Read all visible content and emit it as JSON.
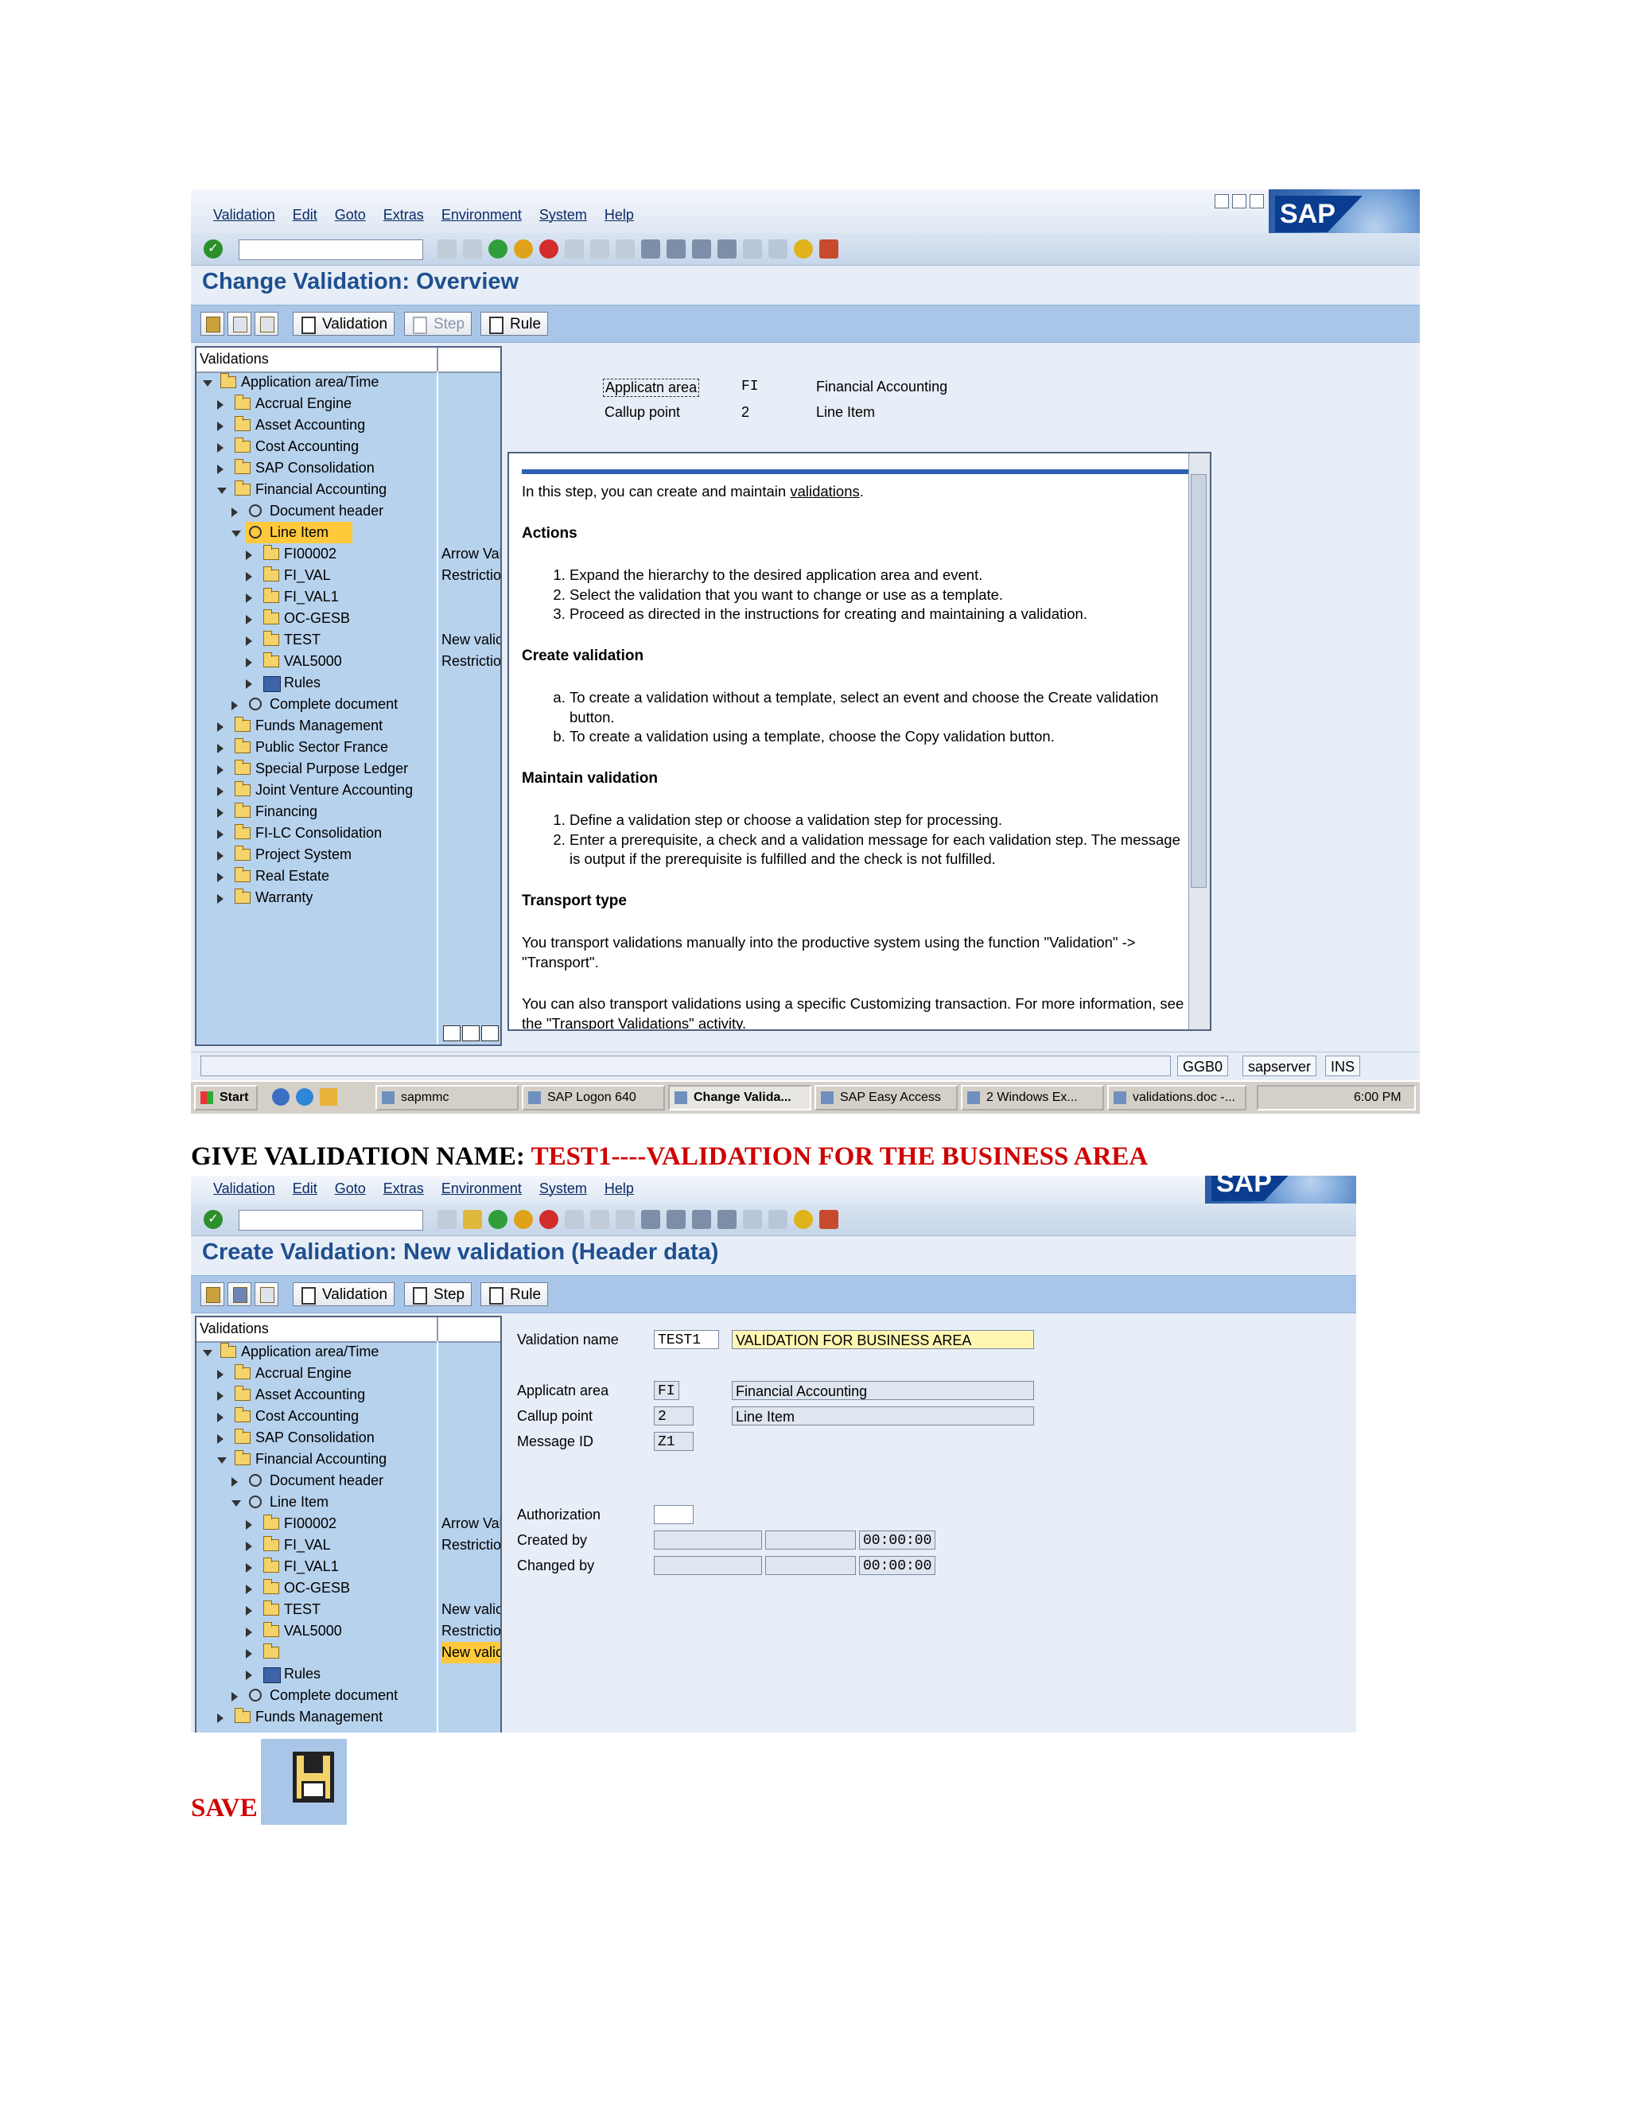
{
  "screen1": {
    "menu": [
      "Validation",
      "Edit",
      "Goto",
      "Extras",
      "Environment",
      "System",
      "Help"
    ],
    "logo_text": "SAP",
    "page_title": "Change Validation: Overview",
    "app_toolbar": {
      "validation": "Validation",
      "step": "Step",
      "rule": "Rule"
    },
    "tree_header": "Validations",
    "tree": [
      {
        "label": "Application area/Time",
        "level": 0,
        "expanded": true,
        "icon": "folder-icon"
      },
      {
        "label": "Accrual Engine",
        "level": 1,
        "icon": "folder-icon"
      },
      {
        "label": "Asset Accounting",
        "level": 1,
        "icon": "folder-icon"
      },
      {
        "label": "Cost Accounting",
        "level": 1,
        "icon": "folder-icon"
      },
      {
        "label": "SAP Consolidation",
        "level": 1,
        "icon": "folder-icon"
      },
      {
        "label": "Financial Accounting",
        "level": 1,
        "expanded": true,
        "icon": "folder-icon"
      },
      {
        "label": "Document header",
        "level": 2,
        "icon": "clock-icon"
      },
      {
        "label": "Line Item",
        "level": 2,
        "expanded": true,
        "icon": "clock-icon",
        "highlight": true
      },
      {
        "label": "FI00002",
        "level": 3,
        "icon": "folder-icon",
        "extra": "Arrow Val"
      },
      {
        "label": "FI_VAL",
        "level": 3,
        "icon": "folder-icon",
        "extra": "Restrictio"
      },
      {
        "label": "FI_VAL1",
        "level": 3,
        "icon": "folder-icon"
      },
      {
        "label": "OC-GESB",
        "level": 3,
        "icon": "folder-icon"
      },
      {
        "label": "TEST",
        "level": 3,
        "icon": "folder-icon",
        "extra": "New valic"
      },
      {
        "label": "VAL5000",
        "level": 3,
        "icon": "folder-icon",
        "extra": "Restrictio"
      },
      {
        "label": "Rules",
        "level": 3,
        "icon": "rules-icon"
      },
      {
        "label": "Complete document",
        "level": 2,
        "icon": "clock-icon"
      },
      {
        "label": "Funds Management",
        "level": 1,
        "icon": "folder-icon"
      },
      {
        "label": "Public Sector France",
        "level": 1,
        "icon": "folder-icon"
      },
      {
        "label": "Special Purpose Ledger",
        "level": 1,
        "icon": "folder-icon"
      },
      {
        "label": "Joint Venture Accounting",
        "level": 1,
        "icon": "folder-icon"
      },
      {
        "label": "Financing",
        "level": 1,
        "icon": "folder-icon"
      },
      {
        "label": "FI-LC Consolidation",
        "level": 1,
        "icon": "folder-icon"
      },
      {
        "label": "Project System",
        "level": 1,
        "icon": "folder-icon"
      },
      {
        "label": "Real Estate",
        "level": 1,
        "icon": "folder-icon"
      },
      {
        "label": "Warranty",
        "level": 1,
        "icon": "folder-icon"
      }
    ],
    "fields": {
      "app_area_label": "Applicatn area",
      "app_area_value": "FI",
      "app_area_text": "Financial Accounting",
      "callup_label": "Callup point",
      "callup_value": "2",
      "callup_text": "Line Item"
    },
    "help": {
      "intro_pre": "In this step, you can create and maintain ",
      "intro_link": "validations",
      "intro_post": ".",
      "actions_title": "Actions",
      "actions": [
        "Expand the hierarchy to the desired application area and event.",
        "Select the validation that you want to change or use as a template.",
        "Proceed as directed in the instructions for creating and maintaining a validation."
      ],
      "create_title": "Create validation",
      "create_items": [
        "To create a validation without a template, select an event and choose the Create validation button.",
        "To create a validation using a template, choose the Copy validation button."
      ],
      "maintain_title": "Maintain validation",
      "maintain_items": [
        "Define a validation step or choose a validation step for processing.",
        "Enter a prerequisite, a check and a validation message for each validation step. The message is output if the prerequisite is fulfilled and the check is not fulfilled."
      ],
      "transport_title": "Transport type",
      "transport_p1": "You transport validations manually into the productive system using the function \"Validation\" -> \"Transport\".",
      "transport_p2_pre": "You can also transport validations using a specific Customizing transaction. For more information, see the ",
      "transport_p2_link": "\"Transport Validations\"",
      "transport_p2_post": " activity."
    },
    "status": {
      "tcode": "GGB0",
      "server": "sapserver",
      "mode": "INS"
    }
  },
  "taskbar": {
    "start": "Start",
    "items": [
      "sapmmc",
      "SAP Logon 640",
      "Change Valida...",
      "SAP Easy Access",
      "2 Windows Ex...",
      "validations.doc -..."
    ],
    "clock": "6:00 PM"
  },
  "heading": {
    "prefix": "GIVE VALIDATION NAME: ",
    "highlight": "TEST1----VALIDATION FOR THE BUSINESS AREA"
  },
  "screen2": {
    "menu": [
      "Validation",
      "Edit",
      "Goto",
      "Extras",
      "Environment",
      "System",
      "Help"
    ],
    "page_title": "Create Validation: New validation (Header data)",
    "app_toolbar": {
      "validation": "Validation",
      "step": "Step",
      "rule": "Rule"
    },
    "tree_header": "Validations",
    "tree": [
      {
        "label": "Application area/Time",
        "level": 0,
        "expanded": true,
        "icon": "folder-icon"
      },
      {
        "label": "Accrual Engine",
        "level": 1,
        "icon": "folder-icon"
      },
      {
        "label": "Asset Accounting",
        "level": 1,
        "icon": "folder-icon"
      },
      {
        "label": "Cost Accounting",
        "level": 1,
        "icon": "folder-icon"
      },
      {
        "label": "SAP Consolidation",
        "level": 1,
        "icon": "folder-icon"
      },
      {
        "label": "Financial Accounting",
        "level": 1,
        "expanded": true,
        "icon": "folder-icon"
      },
      {
        "label": "Document header",
        "level": 2,
        "icon": "clock-icon"
      },
      {
        "label": "Line Item",
        "level": 2,
        "expanded": true,
        "icon": "clock-icon"
      },
      {
        "label": "FI00002",
        "level": 3,
        "icon": "folder-icon",
        "extra": "Arrow Val"
      },
      {
        "label": "FI_VAL",
        "level": 3,
        "icon": "folder-icon",
        "extra": "Restrictio"
      },
      {
        "label": "FI_VAL1",
        "level": 3,
        "icon": "folder-icon"
      },
      {
        "label": "OC-GESB",
        "level": 3,
        "icon": "folder-icon"
      },
      {
        "label": "TEST",
        "level": 3,
        "icon": "folder-icon",
        "extra": "New valic"
      },
      {
        "label": "VAL5000",
        "level": 3,
        "icon": "folder-icon",
        "extra": "Restrictio"
      },
      {
        "label": "",
        "level": 3,
        "icon": "folder-icon",
        "extra": "New valic",
        "highlight": true
      },
      {
        "label": "Rules",
        "level": 3,
        "icon": "rules-icon"
      },
      {
        "label": "Complete document",
        "level": 2,
        "icon": "clock-icon"
      },
      {
        "label": "Funds Management",
        "level": 1,
        "icon": "folder-icon"
      }
    ],
    "form": {
      "name_label": "Validation name",
      "name_value": "TEST1",
      "desc_value": "VALIDATION FOR BUSINESS AREA",
      "app_area_label": "Applicatn area",
      "app_area_value": "FI",
      "app_area_text": "Financial Accounting",
      "callup_label": "Callup point",
      "callup_value": "2",
      "callup_text": "Line Item",
      "msgid_label": "Message ID",
      "msgid_value": "Z1",
      "auth_label": "Authorization",
      "created_label": "Created by",
      "created_time": "00:00:00",
      "changed_label": "Changed by",
      "changed_time": "00:00:00"
    }
  },
  "save_label": "SAVE"
}
